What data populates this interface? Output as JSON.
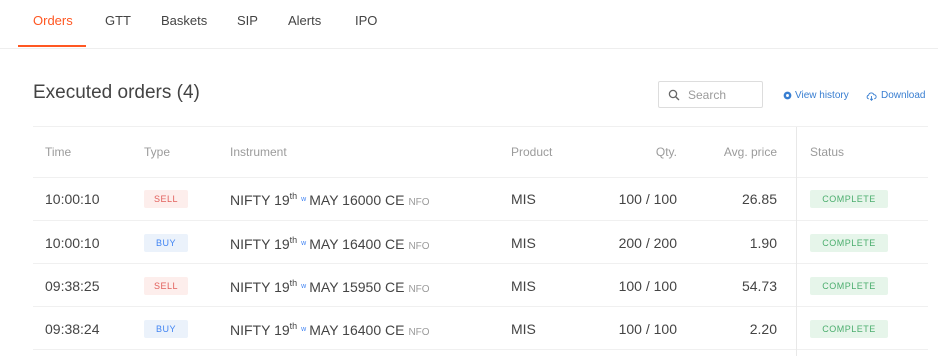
{
  "tabs": [
    "Orders",
    "GTT",
    "Baskets",
    "SIP",
    "Alerts",
    "IPO"
  ],
  "header": {
    "title": "Executed orders (4)",
    "search_placeholder": "Search",
    "view_history": "View history",
    "download": "Download"
  },
  "table": {
    "columns": [
      "Time",
      "Type",
      "Instrument",
      "Product",
      "Qty.",
      "Avg. price",
      "Status"
    ],
    "rows": [
      {
        "time": "10:00:10",
        "type": "SELL",
        "inst_base": "NIFTY 19",
        "inst_sup": "th",
        "inst_w": "w",
        "inst_rest": "MAY 16000 CE",
        "exchange": "NFO",
        "product": "MIS",
        "qty": "100 / 100",
        "avg_price": "26.85",
        "status": "COMPLETE"
      },
      {
        "time": "10:00:10",
        "type": "BUY",
        "inst_base": "NIFTY 19",
        "inst_sup": "th",
        "inst_w": "w",
        "inst_rest": "MAY 16400 CE",
        "exchange": "NFO",
        "product": "MIS",
        "qty": "200 / 200",
        "avg_price": "1.90",
        "status": "COMPLETE"
      },
      {
        "time": "09:38:25",
        "type": "SELL",
        "inst_base": "NIFTY 19",
        "inst_sup": "th",
        "inst_w": "w",
        "inst_rest": "MAY 15950 CE",
        "exchange": "NFO",
        "product": "MIS",
        "qty": "100 / 100",
        "avg_price": "54.73",
        "status": "COMPLETE"
      },
      {
        "time": "09:38:24",
        "type": "BUY",
        "inst_base": "NIFTY 19",
        "inst_sup": "th",
        "inst_w": "w",
        "inst_rest": "MAY 16400 CE",
        "exchange": "NFO",
        "product": "MIS",
        "qty": "100 / 100",
        "avg_price": "2.20",
        "status": "COMPLETE"
      }
    ]
  },
  "colors": {
    "accent": "#ff5722",
    "link": "#387ed1",
    "sell_text": "#e25f5b",
    "buy_text": "#4184f3",
    "complete_text": "#4cae6e"
  },
  "icons": {
    "search": "search-icon",
    "history": "history-icon",
    "download": "download-icon"
  }
}
